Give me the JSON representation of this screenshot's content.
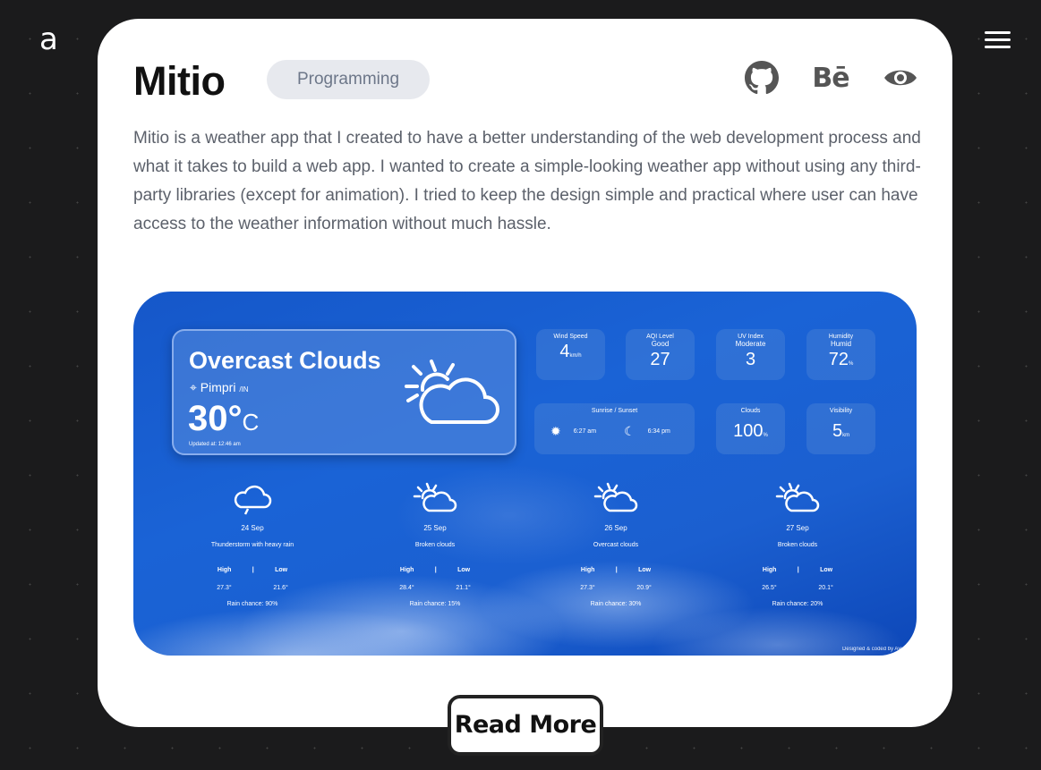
{
  "header": {
    "logo": "a",
    "menu_icon": "hamburger-icon"
  },
  "project": {
    "title": "Mitio",
    "tag": "Programming",
    "links": [
      {
        "icon": "github-icon"
      },
      {
        "icon": "behance-icon",
        "glyph": "Bē"
      },
      {
        "icon": "eye-icon"
      }
    ],
    "description": "Mitio is a weather app that I created to have a better understanding of the web development process and what it takes to build a web app. I wanted to create a simple-looking weather app without using any third-party libraries (except for animation). I tried to keep the design simple and practical where user can have access to the weather information without much hassle."
  },
  "preview": {
    "current": {
      "condition": "Overcast Clouds",
      "city": "Pimpri",
      "country": "/IN",
      "temp": "30°",
      "unit": "C",
      "updated": "Updated at: 12:46 am"
    },
    "stats": {
      "wind": {
        "label": "Wind Speed",
        "value": "4",
        "unit": "km/h"
      },
      "aqi": {
        "label": "AQI Level",
        "sub": "Good",
        "value": "27"
      },
      "uv": {
        "label": "UV Index",
        "sub": "Moderate",
        "value": "3"
      },
      "humidity": {
        "label": "Humidity",
        "sub": "Humid",
        "value": "72",
        "unit": "%"
      },
      "sun": {
        "label": "Sunrise / Sunset",
        "sunrise": "6:27 am",
        "sunset": "6:34 pm"
      },
      "clouds": {
        "label": "Clouds",
        "value": "100",
        "unit": "%"
      },
      "visibility": {
        "label": "Visibility",
        "value": "5",
        "unit": "km"
      }
    },
    "forecast": [
      {
        "date": "24 Sep",
        "desc": "Thunderstorm with heavy rain",
        "high": "27.3°",
        "low": "21.6°",
        "rain": "Rain chance: 90%"
      },
      {
        "date": "25 Sep",
        "desc": "Broken clouds",
        "high": "28.4°",
        "low": "21.1°",
        "rain": "Rain chance: 15%"
      },
      {
        "date": "26 Sep",
        "desc": "Overcast clouds",
        "high": "27.3°",
        "low": "20.9°",
        "rain": "Rain chance: 30%"
      },
      {
        "date": "27 Sep",
        "desc": "Broken clouds",
        "high": "26.5°",
        "low": "20.1°",
        "rain": "Rain chance: 20%"
      }
    ],
    "labels": {
      "high": "High",
      "low": "Low",
      "sep": "|"
    },
    "credit": "Designed & coded by Ayush"
  },
  "cta": {
    "label": "Read More"
  },
  "colors": {
    "background": "#1b1b1c",
    "card": "#ffffff",
    "preview": "#1a63d6"
  }
}
